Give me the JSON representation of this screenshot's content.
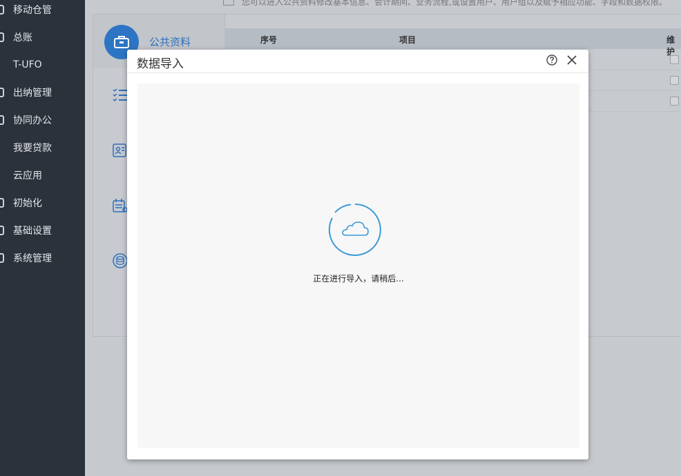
{
  "sidebar": {
    "items": [
      {
        "label": "移动仓管"
      },
      {
        "label": "总账"
      },
      {
        "label": "T-UFO"
      },
      {
        "label": "出纳管理"
      },
      {
        "label": "协同办公"
      },
      {
        "label": "我要贷款"
      },
      {
        "label": "云应用"
      },
      {
        "label": "初始化"
      },
      {
        "label": "基础设置"
      },
      {
        "label": "系统管理"
      }
    ]
  },
  "main": {
    "notice": "您可以进入公共资料修改基本信息、会计期间、业务流程,或设置用户、用户组以及赋予相应功能、字段和数据权限。",
    "active_category": "公共资料",
    "table": {
      "headers": [
        "序号",
        "项目",
        "维护"
      ]
    }
  },
  "modal": {
    "title": "数据导入",
    "loading_text": "正在进行导入，请稍后..."
  },
  "colors": {
    "sidebar_bg": "#2b323c",
    "accent": "#2d75c4",
    "loader": "#3a9ad9"
  }
}
